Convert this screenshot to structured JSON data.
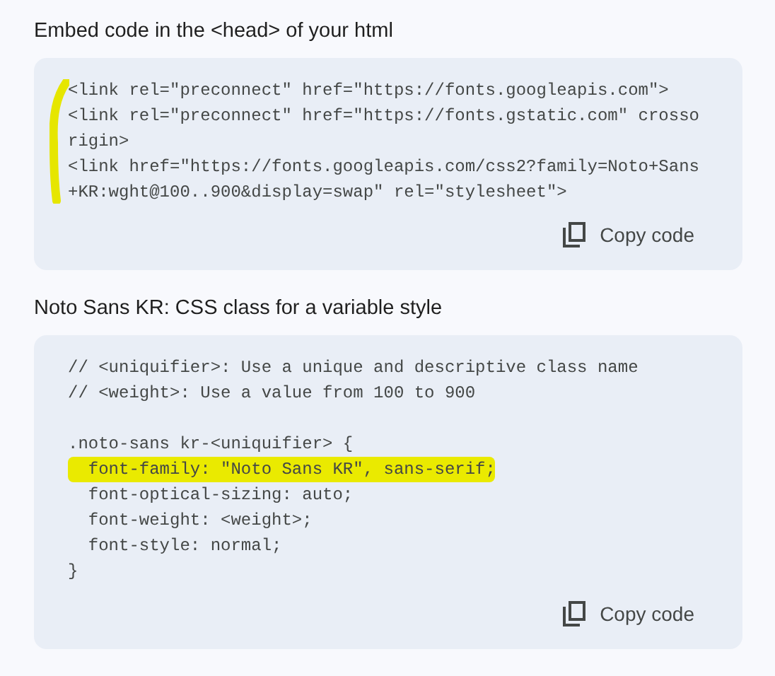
{
  "sections": [
    {
      "title": "Embed code in the <head> of your html",
      "marked": true,
      "lines": [
        {
          "text": "<link rel=\"preconnect\" href=\"https://fonts.googleapis.com\">",
          "highlighted": false
        },
        {
          "text": "<link rel=\"preconnect\" href=\"https://fonts.gstatic.com\" crosso",
          "highlighted": false
        },
        {
          "text": "rigin>",
          "highlighted": false
        },
        {
          "text": "<link href=\"https://fonts.googleapis.com/css2?family=Noto+Sans",
          "highlighted": false
        },
        {
          "text": "+KR:wght@100..900&display=swap\" rel=\"stylesheet\">",
          "highlighted": false
        }
      ],
      "button": "Copy code"
    },
    {
      "title": "Noto Sans KR: CSS class for a variable style",
      "marked": false,
      "lines": [
        {
          "text": "// <uniquifier>: Use a unique and descriptive class name",
          "highlighted": false
        },
        {
          "text": "// <weight>: Use a value from 100 to 900",
          "highlighted": false
        },
        {
          "kind": "blank"
        },
        {
          "text": ".noto-sans kr-<uniquifier> {",
          "highlighted": false
        },
        {
          "text": "  font-family: \"Noto Sans KR\", sans-serif;",
          "highlighted": true
        },
        {
          "text": "  font-optical-sizing: auto;",
          "highlighted": false
        },
        {
          "text": "  font-weight: <weight>;",
          "highlighted": false
        },
        {
          "text": "  font-style: normal;",
          "highlighted": false
        },
        {
          "text": "}",
          "highlighted": false
        }
      ],
      "button": "Copy code"
    }
  ]
}
